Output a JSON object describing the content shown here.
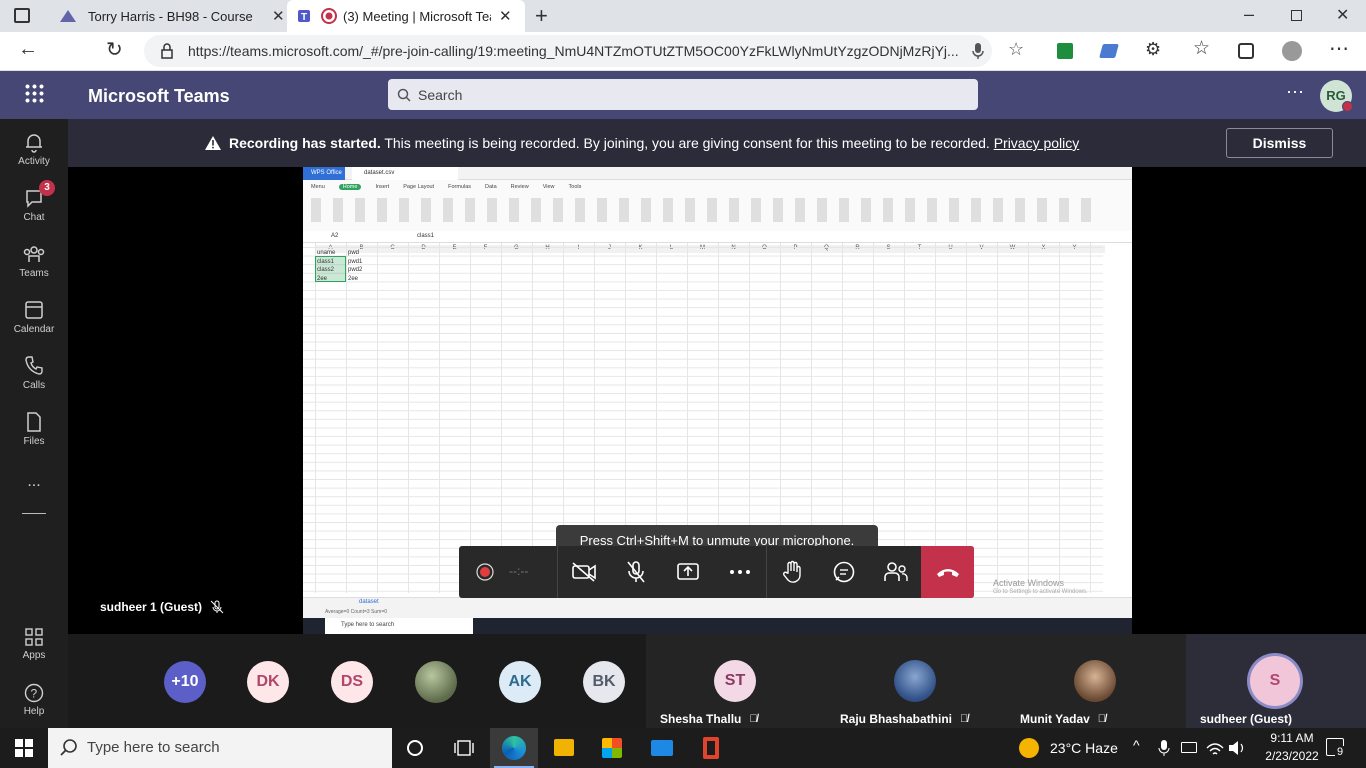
{
  "browser": {
    "tabs": [
      {
        "title": "Torry Harris - BH98 - Course"
      },
      {
        "title": "(3) Meeting | Microsoft Teams"
      }
    ],
    "url": "https://teams.microsoft.com/_#/pre-join-calling/19:meeting_NmU4NTZmOTUtZTM5OC00YzFkLWlyNmUtYzgzODNjMzRjYj..."
  },
  "teams": {
    "app_name": "Microsoft Teams",
    "search_placeholder": "Search",
    "avatar_initials": "RG",
    "nav": [
      {
        "label": "Activity",
        "icon": "bell-icon"
      },
      {
        "label": "Chat",
        "icon": "chat-icon",
        "badge": "3"
      },
      {
        "label": "Teams",
        "icon": "teams-icon"
      },
      {
        "label": "Calendar",
        "icon": "calendar-icon"
      },
      {
        "label": "Calls",
        "icon": "phone-icon"
      },
      {
        "label": "Files",
        "icon": "file-icon"
      },
      {
        "label": "...",
        "icon": "more-icon"
      },
      {
        "label": "Apps",
        "icon": "apps-icon"
      },
      {
        "label": "Help",
        "icon": "help-icon"
      }
    ]
  },
  "banner": {
    "bold": "Recording has started.",
    "text": "This meeting is being recorded. By joining, you are giving consent for this meeting to be recorded.",
    "link": "Privacy policy",
    "dismiss": "Dismiss"
  },
  "stage": {
    "presenter": "sudheer 1 (Guest)",
    "sheet": {
      "app": "WPS Office",
      "file": "dataset.csv",
      "cell_ref": "A2",
      "formula": "class1",
      "ribbon_tabs": [
        "Menu",
        "Home",
        "Insert",
        "Page Layout",
        "Formulas",
        "Data",
        "Review",
        "View",
        "Tools"
      ],
      "columns": [
        "A",
        "B",
        "C",
        "D",
        "E",
        "F",
        "G",
        "H",
        "I",
        "J",
        "K",
        "L",
        "M",
        "N",
        "O",
        "P",
        "Q",
        "R",
        "S",
        "T",
        "U",
        "V",
        "W",
        "X",
        "Y"
      ],
      "rows": [
        [
          "uname",
          "pwd"
        ],
        [
          "class1",
          "pwd1"
        ],
        [
          "class2",
          "pwd2"
        ],
        [
          "2ee",
          "2ee"
        ]
      ],
      "sheet_tab": "dataset",
      "watermark": "Activate Windows",
      "watermark_sub": "Go to Settings to activate Windows.",
      "taskbar_search": "Type here to search",
      "status": "Average=0 Count=3 Sum=0"
    }
  },
  "call": {
    "hint": "Press Ctrl+Shift+M to unmute your microphone.",
    "timer": "--:--"
  },
  "participants": {
    "avatars": [
      {
        "initials": "+10",
        "color": "#5b5fc7"
      },
      {
        "initials": "DK",
        "color": "#fde7e9"
      },
      {
        "initials": "DS",
        "color": "#fde7e9"
      },
      {
        "initials": "",
        "color": "#7a8a6a"
      },
      {
        "initials": "AK",
        "color": "#dcebf5"
      },
      {
        "initials": "BK",
        "color": "#e6e8ee"
      }
    ],
    "tiles": [
      {
        "initials": "ST",
        "name": "Shesha Thallu",
        "color": "#f3d9e6"
      },
      {
        "initials": "",
        "name": "Raju Bhashabathini",
        "color": "#5577aa"
      },
      {
        "initials": "",
        "name": "Munit Yadav",
        "color": "#b08a6a"
      },
      {
        "initials": "S",
        "name": "sudheer (Guest)",
        "color": "#f0c6d8"
      }
    ]
  },
  "taskbar": {
    "search": "Type here to search",
    "weather": "23°C  Haze",
    "time": "9:11 AM",
    "date": "2/23/2022",
    "notif": "9"
  }
}
